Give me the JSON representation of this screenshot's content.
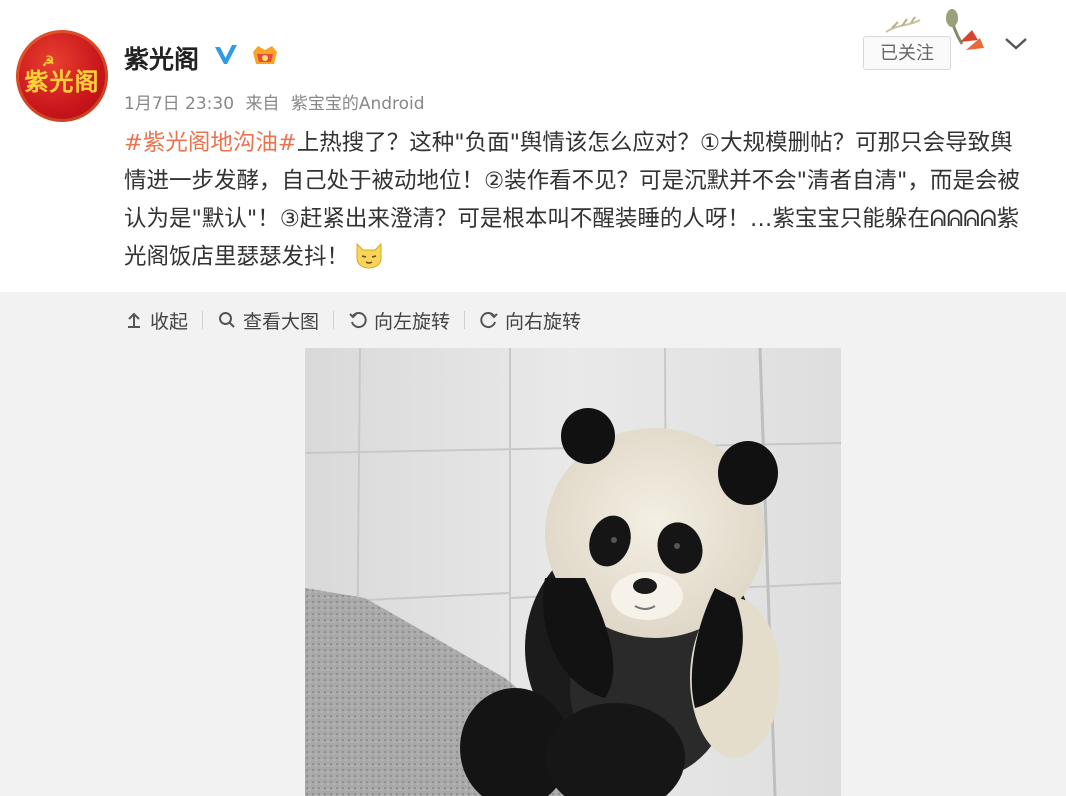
{
  "user": {
    "name": "紫光阁",
    "avatar_text": "紫光阁",
    "avatar_icon": "party-emblem-icon",
    "verified_icon": "verified-v-icon",
    "badge_icon": "member-badge-icon",
    "follow_label": "已关注"
  },
  "meta": {
    "date": "1月7日 23:30",
    "source_prefix": "来自",
    "source": "紫宝宝的Android"
  },
  "post": {
    "hashtag": "#紫光阁地沟油#",
    "body": "上热搜了？这种\"负面\"舆情该怎么应对？①大规模删帖？可那只会导致舆情进一步发酵，自己处于被动地位！②装作看不见？可是沉默并不会\"清者自清\"，而是会被认为是\"默认\"！③赶紧出来澄清？可是根本叫不醒装睡的人呀！…紫宝宝只能躲在ᕱᕱᕱᕱ紫光阁饭店里瑟瑟发抖！",
    "emoji": "cat-face-emoji"
  },
  "toolbar": {
    "collapse": "收起",
    "view_large": "查看大图",
    "rotate_left": "向左旋转",
    "rotate_right": "向右旋转"
  },
  "image": {
    "subject": "panda-cub-photo"
  },
  "colors": {
    "hashtag": "#eb7350",
    "verified": "#2f9be6",
    "avatar_bg": "#c8151b"
  }
}
